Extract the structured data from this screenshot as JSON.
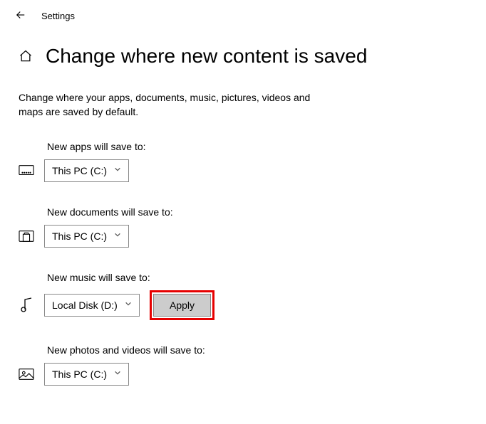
{
  "header": {
    "app_title": "Settings"
  },
  "page": {
    "title": "Change where new content is saved",
    "description": "Change where your apps, documents, music, pictures, videos and maps are saved by default."
  },
  "settings": {
    "apps": {
      "label": "New apps will save to:",
      "selected": "This PC (C:)"
    },
    "documents": {
      "label": "New documents will save to:",
      "selected": "This PC (C:)"
    },
    "music": {
      "label": "New music will save to:",
      "selected": "Local Disk (D:)",
      "apply_label": "Apply"
    },
    "photos": {
      "label": "New photos and videos will save to:",
      "selected": "This PC (C:)"
    }
  }
}
